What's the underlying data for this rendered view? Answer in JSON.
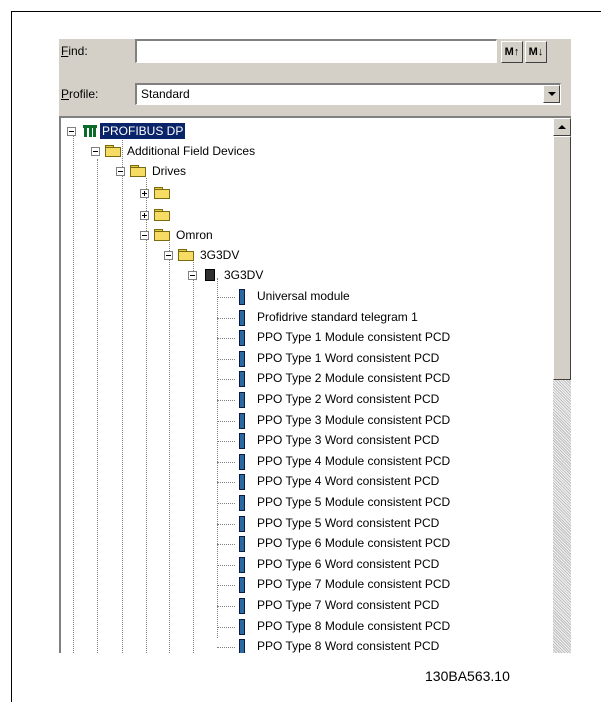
{
  "find": {
    "label": "Find:",
    "value": "",
    "btn_prev": "M↑",
    "btn_next": "M↓"
  },
  "profile": {
    "label": "Profile:",
    "value": "Standard"
  },
  "tree": {
    "root": "PROFIBUS DP",
    "additional": "Additional Field Devices",
    "drives": "Drives",
    "omron": "Omron",
    "family": "3G3DV",
    "device": "3G3DV",
    "modules": [
      "Universal module",
      "Profidrive standard telegram 1",
      "PPO Type 1 Module consistent PCD",
      "PPO Type 1 Word consistent PCD",
      "PPO Type 2 Module consistent PCD",
      "PPO Type 2 Word consistent PCD",
      "PPO Type 3 Module consistent PCD",
      "PPO Type 3 Word consistent PCD",
      "PPO Type 4 Module consistent PCD",
      "PPO Type 4 Word consistent PCD",
      "PPO Type 5 Module consistent PCD",
      "PPO Type 5 Word consistent PCD",
      "PPO Type 6 Module consistent PCD",
      "PPO Type 6 Word consistent PCD",
      "PPO Type 7 Module consistent PCD",
      "PPO Type 7 Word consistent PCD",
      "PPO Type 8 Module consistent PCD",
      "PPO Type 8 Word consistent PCD"
    ]
  },
  "figure_id": "130BA563.10",
  "colors": {
    "selection": "#0a246a",
    "panel": "#d4d0c8",
    "folder": "#f6dc62",
    "module": "#2a6aa0"
  }
}
